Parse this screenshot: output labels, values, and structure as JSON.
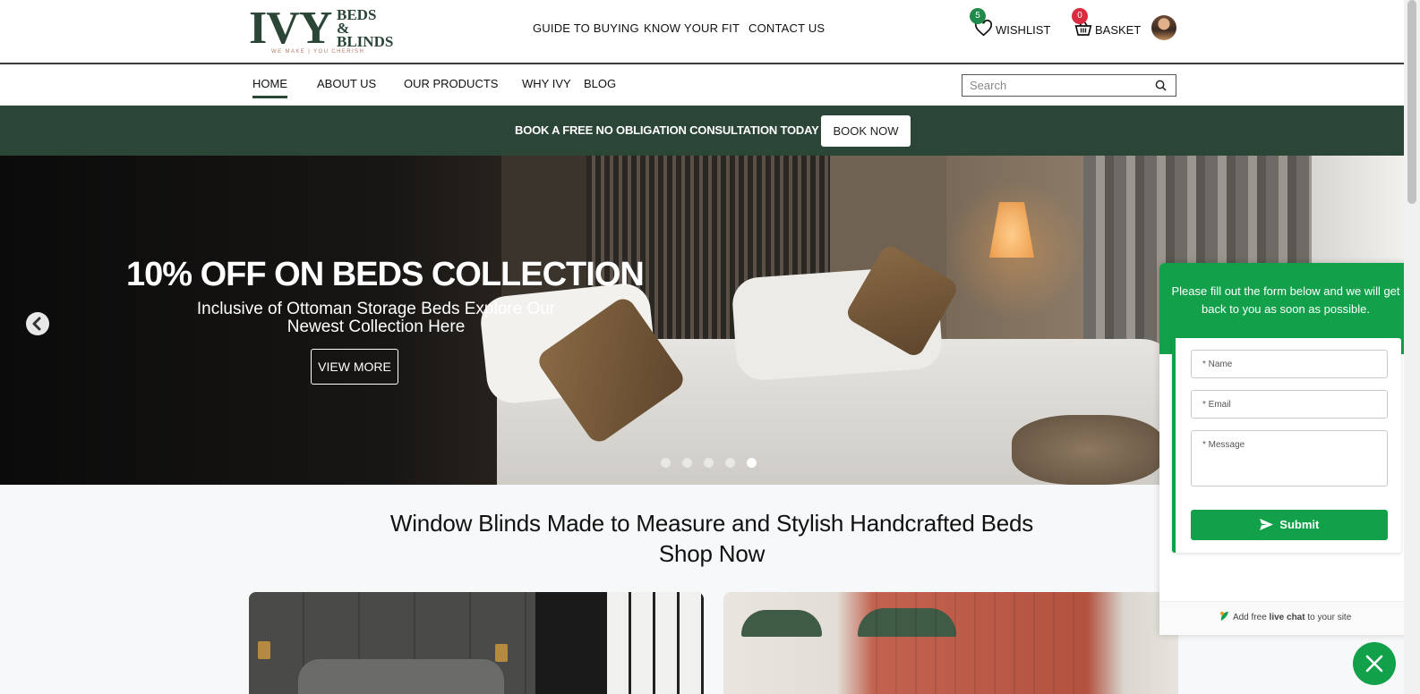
{
  "brand": {
    "logo_main": "IVY",
    "logo_line1": "BEDS",
    "logo_line2": "&",
    "logo_line3": "BLINDS",
    "logo_tagline": "WE MAKE | YOU CHERISH",
    "color_primary": "#2b4537",
    "color_chat": "#12a14a"
  },
  "top_links": [
    "GUIDE TO BUYING",
    "KNOW YOUR FIT",
    "CONTACT US"
  ],
  "wishlist": {
    "label": "WISHLIST",
    "count": "5",
    "icon": "heart-icon"
  },
  "basket": {
    "label": "BASKET",
    "count": "0",
    "icon": "basket-icon"
  },
  "nav": {
    "items": [
      "HOME",
      "ABOUT US",
      "OUR PRODUCTS",
      "WHY IVY",
      "BLOG"
    ],
    "active": "HOME"
  },
  "search": {
    "placeholder": "Search",
    "icon": "search-icon"
  },
  "promo": {
    "text": "BOOK A FREE NO OBLIGATION CONSULTATION TODAY",
    "button": "BOOK NOW"
  },
  "hero": {
    "title": "10% OFF ON BEDS COLLECTION",
    "subtitle": "Inclusive of Ottoman Storage Beds Explore Our Newest Collection Here",
    "button": "VIEW MORE",
    "slide_count": 5,
    "active_slide": 5
  },
  "main": {
    "heading_line1": "Window Blinds Made to Measure and Stylish Handcrafted Beds",
    "heading_line2": "Shop Now"
  },
  "chat": {
    "message": "Please fill out the form below and we will get back to you as soon as possible.",
    "name_placeholder": "* Name",
    "email_placeholder": "* Email",
    "message_placeholder": "* Message",
    "submit": "Submit",
    "footer_prefix": "Add free ",
    "footer_bold": "live chat",
    "footer_suffix": " to your site"
  }
}
